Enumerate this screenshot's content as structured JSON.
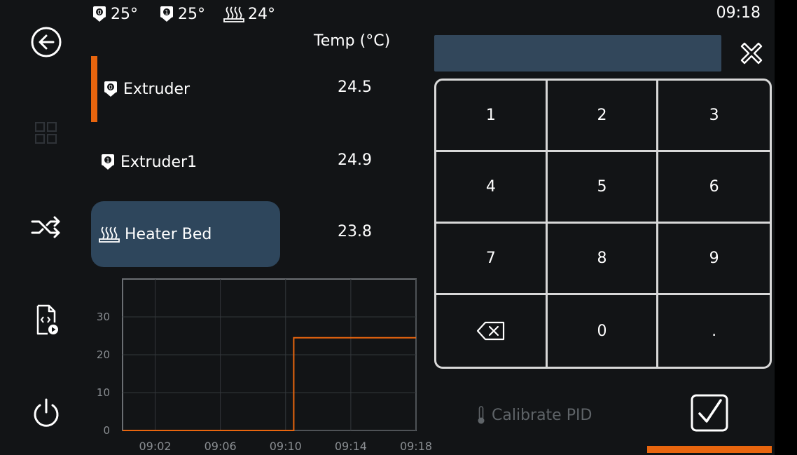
{
  "status_bar": {
    "extruder0_temp": "25°",
    "extruder1_temp": "25°",
    "bed_temp": "24°",
    "time": "09:18"
  },
  "sidebar": {
    "items": [
      {
        "name": "back",
        "icon": "back-arrow-icon"
      },
      {
        "name": "grid",
        "icon": "grid-icon"
      },
      {
        "name": "shuffle",
        "icon": "shuffle-icon"
      },
      {
        "name": "file",
        "icon": "gcode-file-play-icon"
      },
      {
        "name": "power",
        "icon": "power-icon"
      }
    ]
  },
  "table": {
    "header": "Temp (°C)",
    "rows": [
      {
        "label": "Extruder",
        "value": "24.5",
        "icon": "extruder-0-icon"
      },
      {
        "label": "Extruder1",
        "value": "24.9",
        "icon": "extruder-1-icon"
      },
      {
        "label": "Heater Bed",
        "value": "23.8",
        "icon": "heater-bed-icon"
      }
    ]
  },
  "input": {
    "value": ""
  },
  "keypad": {
    "keys": [
      "1",
      "2",
      "3",
      "4",
      "5",
      "6",
      "7",
      "8",
      "9",
      "⌫",
      "0",
      "."
    ]
  },
  "calibrate_label": "Calibrate PID",
  "colors": {
    "accent": "#e8650e",
    "selected_bg": "#2e465c",
    "input_bg": "#32475b",
    "background": "#121416"
  },
  "chart_data": {
    "type": "line",
    "x_tick_labels": [
      "09:02",
      "09:06",
      "09:10",
      "09:14",
      "09:18"
    ],
    "y_tick_labels": [
      "0",
      "10",
      "20",
      "30"
    ],
    "ylim": [
      0,
      40
    ],
    "grid": true,
    "series": [
      {
        "color": "#e8650e",
        "x": [
          "09:00",
          "09:10.5",
          "09:10.5",
          "09:18"
        ],
        "values": [
          0,
          0,
          24.5,
          24.5
        ]
      }
    ]
  }
}
